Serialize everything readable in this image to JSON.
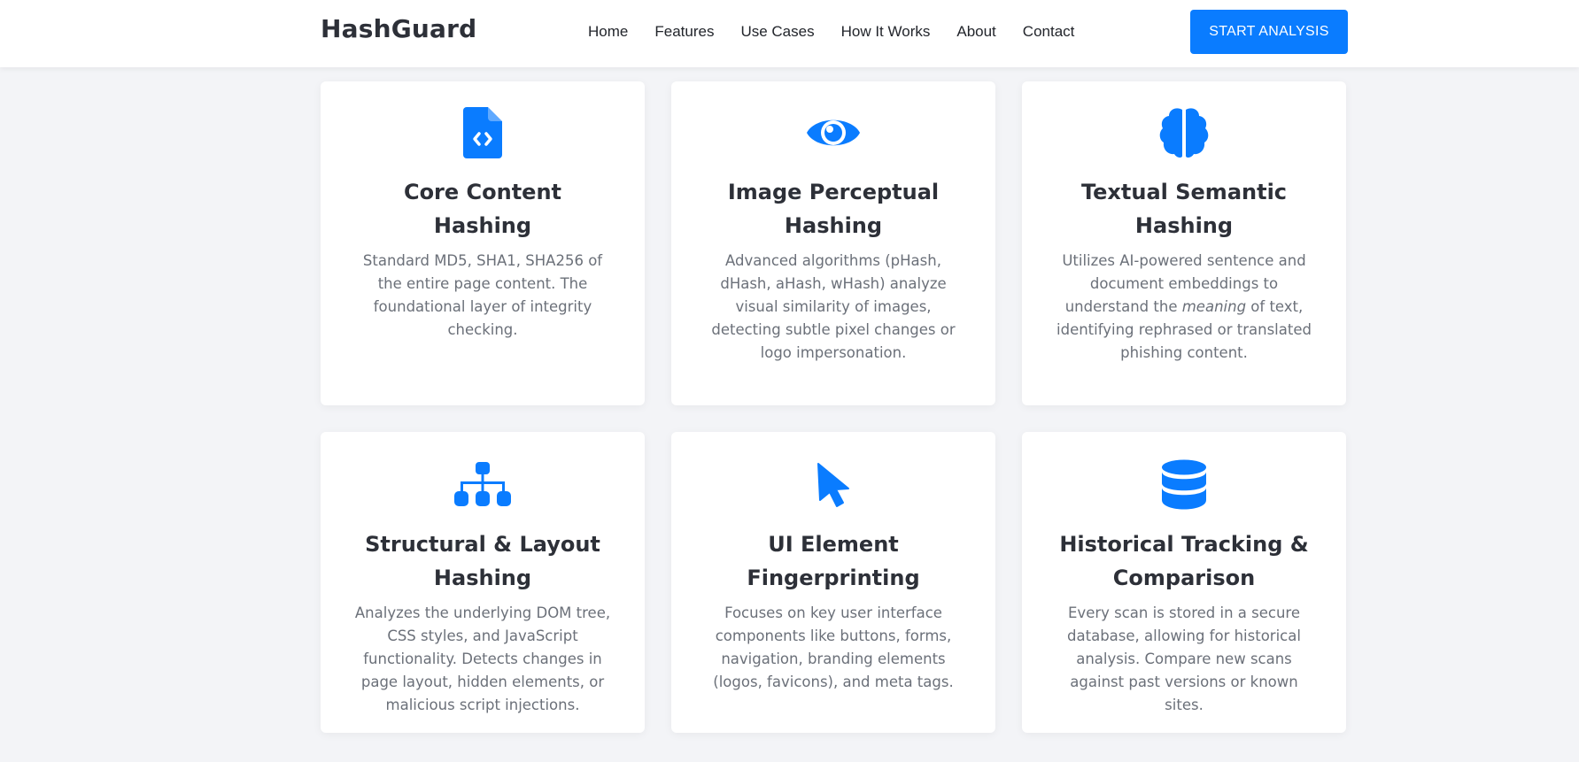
{
  "header": {
    "brand": "HashGuard",
    "nav": [
      "Home",
      "Features",
      "Use Cases",
      "How It Works",
      "About",
      "Contact"
    ],
    "cta_label": "START ANALYSIS"
  },
  "colors": {
    "accent": "#0a7cff",
    "background": "#f3f4f7",
    "heading": "#2d3038",
    "body_text": "#6b7079"
  },
  "features": [
    {
      "icon": "file-code-icon",
      "title": "Core Content Hashing",
      "desc": "Standard MD5, SHA1, SHA256 of the entire page content. The foundational layer of integrity checking."
    },
    {
      "icon": "eye-icon",
      "title": "Image Perceptual Hashing",
      "desc": "Advanced algorithms (pHash, dHash, aHash, wHash) analyze visual similarity of images, detecting subtle pixel changes or logo impersonation."
    },
    {
      "icon": "brain-icon",
      "title": "Textual Semantic Hashing",
      "desc_before": "Utilizes AI-powered sentence and document embeddings to understand the",
      "desc_em": "meaning",
      "desc_after": "of text, identifying rephrased or translated phishing content."
    },
    {
      "icon": "sitemap-icon",
      "title": "Structural & Layout Hashing",
      "desc": "Analyzes the underlying DOM tree, CSS styles, and JavaScript functionality. Detects changes in page layout, hidden elements, or malicious script injections."
    },
    {
      "icon": "mouse-pointer-icon",
      "title": "UI Element Fingerprinting",
      "desc": "Focuses on key user interface components like buttons, forms, navigation, branding elements (logos, favicons), and meta tags."
    },
    {
      "icon": "database-icon",
      "title": "Historical Tracking & Comparison",
      "desc": "Every scan is stored in a secure database, allowing for historical analysis. Compare new scans against past versions or known sites."
    }
  ]
}
